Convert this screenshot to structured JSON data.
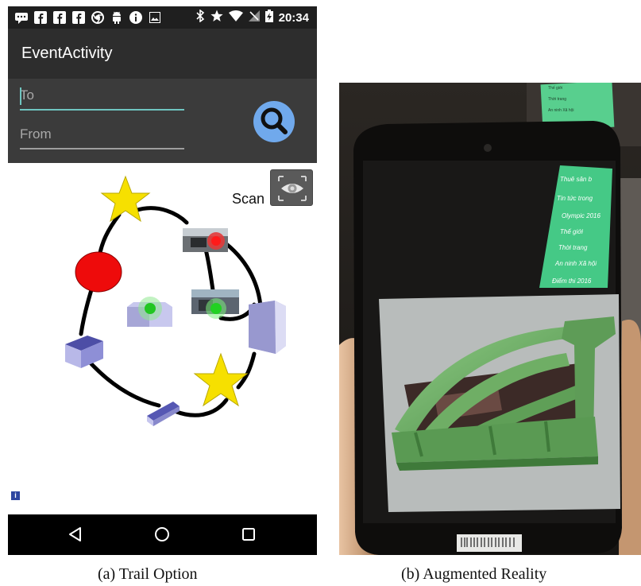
{
  "status_bar": {
    "time": "20:34",
    "left_icons": [
      "message-icon",
      "facebook-icon",
      "facebook-icon",
      "facebook-icon",
      "chrome-icon",
      "android-icon",
      "info-icon",
      "image-icon"
    ],
    "right_icons": [
      "bluetooth-icon",
      "star-icon",
      "wifi-icon",
      "no-signal-icon",
      "battery-charging-icon"
    ]
  },
  "app_bar": {
    "title": "EventActivity"
  },
  "form": {
    "to_placeholder": "To",
    "from_placeholder": "From",
    "search_icon": "search-icon",
    "accent_color": "#6fc5c0",
    "search_button_color": "#70a9ec"
  },
  "map": {
    "scan_label": "Scan",
    "scan_icon": "eye-scan-icon",
    "info_label": "i",
    "markers": [
      "star",
      "photo-marker-red",
      "red-circle",
      "photo-marker-green",
      "green-cube",
      "blue-box",
      "purple-box",
      "star",
      "blue-slab"
    ]
  },
  "nav_bar": {
    "icons": [
      "back-icon",
      "home-icon",
      "recents-icon"
    ]
  },
  "captions": {
    "a": "(a) Trail Option",
    "b": "(b) Augmented Reality"
  },
  "photo_b": {
    "menu_items": [
      "Thuê sân b",
      "Tin tức trong",
      "Olympic 2016",
      "Thế giới",
      "Thời trang",
      "An ninh Xã hội",
      "Điểm thi 2016"
    ],
    "background_note_lines": [
      "Thế giới",
      "Thời trang",
      "An ninh Xã hội"
    ],
    "accent_color": "#41c98a"
  }
}
